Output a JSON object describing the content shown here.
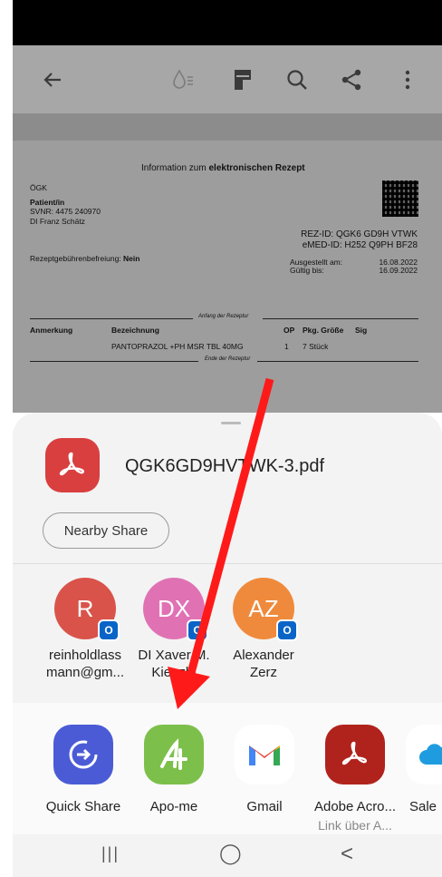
{
  "appbar": {
    "icons": [
      "back-icon",
      "reading-mode-icon",
      "document-icon",
      "search-icon",
      "share-icon",
      "more-icon"
    ]
  },
  "document": {
    "title_prefix": "Information zum ",
    "title_bold": "elektronischen Rezept",
    "org": "ÖGK",
    "patient_label": "Patient/in",
    "svnr": "SVNR: 4475 240970",
    "patient_name": "DI Franz Schätz",
    "rez_id": "REZ-ID: QGK6 GD9H VTWK",
    "emed_id": "eMED-ID: H252 Q9PH BF28",
    "fee_label": "Rezeptgebührenbefreiung: ",
    "fee_value": "Nein",
    "issued_label": "Ausgestellt am:",
    "issued_value": "16.08.2022",
    "valid_label": "Gültig bis:",
    "valid_value": "16.09.2022",
    "start_marker": "Anfang der Rezeptur",
    "end_marker": "Ende der Rezeptur",
    "columns": [
      "Anmerkung",
      "Bezeichnung",
      "OP",
      "Pkg. Größe",
      "Sig"
    ],
    "row": {
      "bezeichnung": "PANTOPRAZOL +PH MSR TBL 40MG",
      "op": "1",
      "pkg": "7 Stück"
    }
  },
  "share_sheet": {
    "filename": "QGK6GD9HVTWK-3.pdf",
    "nearby_share": "Nearby Share",
    "contacts": [
      {
        "initials": "R",
        "color": "#d9534a",
        "label_line1": "reinholdlass",
        "label_line2": "mann@gm..."
      },
      {
        "initials": "DX",
        "color": "#e072b4",
        "label_line1": "DI Xaver M.",
        "label_line2": "Kienzle"
      },
      {
        "initials": "AZ",
        "color": "#ef8a3c",
        "label_line1": "Alexander",
        "label_line2": "Zerz"
      }
    ],
    "apps": [
      {
        "label": "Quick Share",
        "sublabel": ""
      },
      {
        "label": "Apo-me",
        "sublabel": ""
      },
      {
        "label": "Gmail",
        "sublabel": ""
      },
      {
        "label": "Adobe Acro...",
        "sublabel": "Link über A..."
      },
      {
        "label": "Sale",
        "sublabel": ""
      }
    ]
  },
  "navbar": {
    "recents": "|||",
    "home": "◯",
    "back": "<"
  }
}
